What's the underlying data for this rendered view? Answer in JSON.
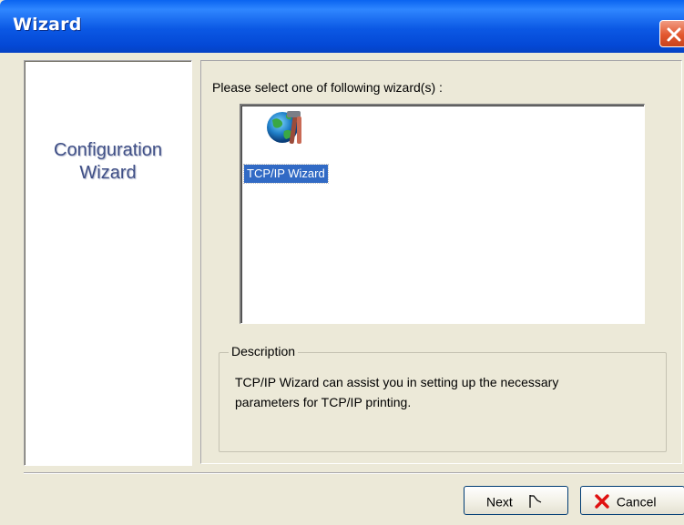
{
  "window": {
    "title": "Wizard",
    "close_icon": "close-x-icon"
  },
  "sidebar": {
    "title_line1": "Configuration",
    "title_line2": "Wizard"
  },
  "main": {
    "select_label": "Please select one of following wizard(s) :",
    "wizards": [
      {
        "label": "TCP/IP Wizard",
        "icon": "globe-tools-icon",
        "selected": true
      }
    ]
  },
  "description": {
    "legend": "Description",
    "line1": "TCP/IP Wizard can assist you in setting up the necessary",
    "line2": "parameters for TCP/IP printing."
  },
  "buttons": {
    "next_label": "Next",
    "next_icon": "flag-icon",
    "cancel_label": "Cancel",
    "cancel_icon": "red-x-icon"
  },
  "colors": {
    "titlebar": "#0b58e4",
    "selection": "#316ac5",
    "sidebar_text": "#3f4f86",
    "cancel_x": "#e01010"
  }
}
